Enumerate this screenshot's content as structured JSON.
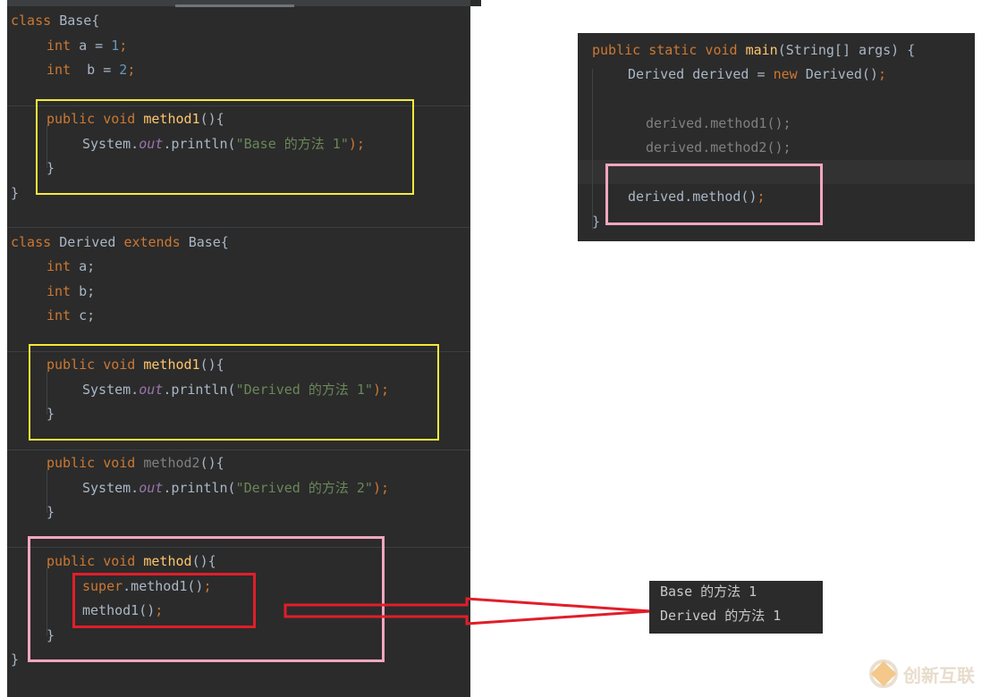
{
  "left_code": {
    "base_class": {
      "header": [
        "class ",
        "Base",
        "{"
      ],
      "field_a": [
        "int ",
        "a = ",
        "1",
        ";"
      ],
      "field_b": [
        "int  ",
        "b = ",
        "2",
        ";"
      ],
      "method1_sig": [
        "public void ",
        "method1",
        "(){"
      ],
      "method1_body": [
        "System.",
        "out",
        ".println(",
        "\"Base 的方法 1\"",
        ");"
      ],
      "close_method": "}",
      "close_class": "}"
    },
    "derived_class": {
      "header": [
        "class ",
        "Derived ",
        "extends ",
        "Base{"
      ],
      "field_a": [
        "int ",
        "a;"
      ],
      "field_b": [
        "int ",
        "b;"
      ],
      "field_c": [
        "int ",
        "c;"
      ],
      "method1_sig": [
        "public void ",
        "method1",
        "(){"
      ],
      "method1_body": [
        "System.",
        "out",
        ".println(",
        "\"Derived 的方法 1\"",
        ");"
      ],
      "method2_sig": [
        "public void ",
        "method2",
        "(){"
      ],
      "method2_body": [
        "System.",
        "out",
        ".println(",
        "\"Derived 的方法 2\"",
        ");"
      ],
      "method_sig": [
        "public void ",
        "method",
        "(){"
      ],
      "super_call": [
        "super",
        ".method1()",
        ";"
      ],
      "method1_call": [
        "method1()",
        ";"
      ],
      "close_method": "}",
      "close_class": "}"
    }
  },
  "right_code": {
    "main_sig": [
      "public static void ",
      "main",
      "(String[] args) {"
    ],
    "decl": [
      "Derived derived = ",
      "new ",
      "Derived()",
      ";"
    ],
    "call1": "derived.method1();",
    "call2": "derived.method2();",
    "call3": [
      "derived.method()",
      ";"
    ],
    "close": "}"
  },
  "output": {
    "line1": "Base 的方法 1",
    "line2": "Derived 的方法 1"
  },
  "colors": {
    "keyword": "#cc7832",
    "function": "#ffc66d",
    "number": "#6897bb",
    "string": "#6a8759",
    "field": "#9876aa",
    "highlight_yellow": "#f5ea3a",
    "highlight_pink": "#f2a6c0",
    "highlight_red": "#e01e2a"
  },
  "watermark": {
    "text": "创新互联"
  }
}
